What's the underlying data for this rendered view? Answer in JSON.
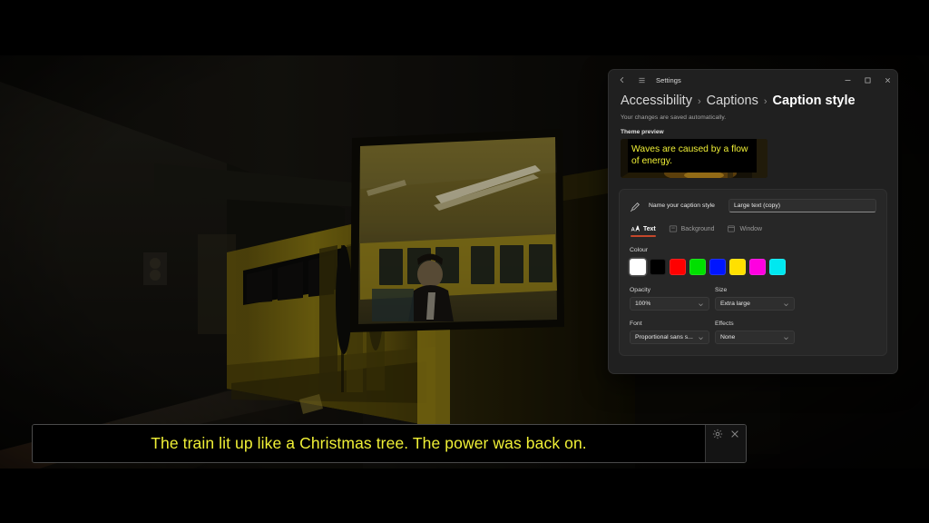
{
  "video": {
    "scene_description": "Dark subway platform with yellow train car at night",
    "letterbox_color": "#000000"
  },
  "caption_overlay": {
    "text": "The train lit up like a Christmas tree. The power was back on.",
    "text_color": "#f0f036",
    "background_color": "#000000",
    "controls": [
      {
        "name": "gear-icon",
        "label": "Settings"
      },
      {
        "name": "close-icon",
        "label": "Close"
      }
    ]
  },
  "settings_window": {
    "app_title": "Settings",
    "titlebar_icons": [
      {
        "name": "back-arrow-icon",
        "label": "Back"
      },
      {
        "name": "hamburger-menu-icon",
        "label": "Menu"
      }
    ],
    "window_controls": [
      {
        "name": "minimize-button",
        "label": "Minimize"
      },
      {
        "name": "maximize-button",
        "label": "Maximize"
      },
      {
        "name": "close-button",
        "label": "Close"
      }
    ],
    "breadcrumb": [
      {
        "label": "Accessibility",
        "current": false
      },
      {
        "label": "Captions",
        "current": false
      },
      {
        "label": "Caption style",
        "current": true
      }
    ],
    "breadcrumb_separator": "›",
    "autosave_note": "Your changes are saved automatically.",
    "theme_preview": {
      "label": "Theme preview",
      "caption_text": "Waves are caused by a flow of energy.",
      "caption_color": "#f0f036"
    },
    "name_row": {
      "icon": "brush-icon",
      "label": "Name your caption style",
      "value": "Large text (copy)",
      "placeholder": "Name your caption style"
    },
    "tabs": [
      {
        "label": "Text",
        "icon": "text-size-icon",
        "active": true
      },
      {
        "label": "Background",
        "icon": "background-icon",
        "active": false
      },
      {
        "label": "Window",
        "icon": "window-icon",
        "active": false
      }
    ],
    "accent_color": "#c4472b",
    "colour": {
      "label": "Colour",
      "swatches": [
        {
          "name": "white",
          "hex": "#ffffff",
          "selected": true
        },
        {
          "name": "black",
          "hex": "#000000",
          "selected": false
        },
        {
          "name": "red",
          "hex": "#ff0000",
          "selected": false
        },
        {
          "name": "green",
          "hex": "#00e000",
          "selected": false
        },
        {
          "name": "blue",
          "hex": "#0015ff",
          "selected": false
        },
        {
          "name": "yellow",
          "hex": "#ffe000",
          "selected": false
        },
        {
          "name": "magenta",
          "hex": "#ff00e0",
          "selected": false
        },
        {
          "name": "cyan",
          "hex": "#00e8f0",
          "selected": false
        }
      ]
    },
    "dropdowns": [
      {
        "label": "Opacity",
        "value": "100%"
      },
      {
        "label": "Size",
        "value": "Extra large"
      },
      {
        "label": "Font",
        "value": "Proportional sans s..."
      },
      {
        "label": "Effects",
        "value": "None"
      }
    ]
  }
}
